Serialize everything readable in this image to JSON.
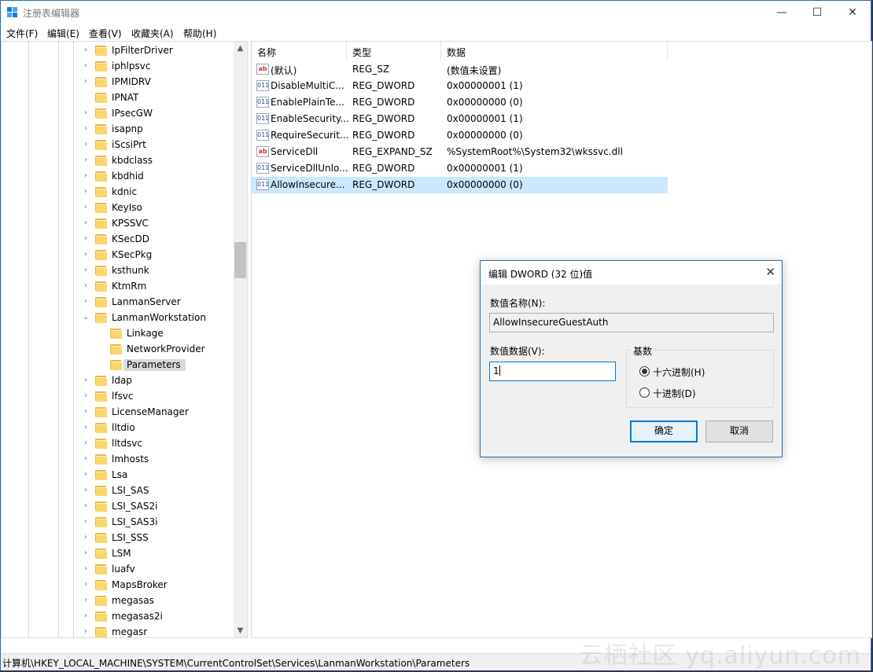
{
  "window": {
    "title": "注册表编辑器",
    "minimize": "—",
    "maximize": "☐",
    "close": "✕"
  },
  "menu": [
    "文件(F)",
    "编辑(E)",
    "查看(V)",
    "收藏夹(A)",
    "帮助(H)"
  ],
  "tree": {
    "items": [
      {
        "label": "IpFilterDriver",
        "depth": 1,
        "expander": "collapsed"
      },
      {
        "label": "iphlpsvc",
        "depth": 1,
        "expander": "collapsed"
      },
      {
        "label": "IPMIDRV",
        "depth": 1,
        "expander": "collapsed"
      },
      {
        "label": "IPNAT",
        "depth": 1,
        "expander": "none"
      },
      {
        "label": "IPsecGW",
        "depth": 1,
        "expander": "collapsed"
      },
      {
        "label": "isapnp",
        "depth": 1,
        "expander": "collapsed"
      },
      {
        "label": "iScsiPrt",
        "depth": 1,
        "expander": "collapsed"
      },
      {
        "label": "kbdclass",
        "depth": 1,
        "expander": "collapsed"
      },
      {
        "label": "kbdhid",
        "depth": 1,
        "expander": "collapsed"
      },
      {
        "label": "kdnic",
        "depth": 1,
        "expander": "collapsed"
      },
      {
        "label": "KeyIso",
        "depth": 1,
        "expander": "collapsed"
      },
      {
        "label": "KPSSVC",
        "depth": 1,
        "expander": "collapsed"
      },
      {
        "label": "KSecDD",
        "depth": 1,
        "expander": "collapsed"
      },
      {
        "label": "KSecPkg",
        "depth": 1,
        "expander": "collapsed"
      },
      {
        "label": "ksthunk",
        "depth": 1,
        "expander": "collapsed"
      },
      {
        "label": "KtmRm",
        "depth": 1,
        "expander": "collapsed"
      },
      {
        "label": "LanmanServer",
        "depth": 1,
        "expander": "collapsed"
      },
      {
        "label": "LanmanWorkstation",
        "depth": 1,
        "expander": "expanded"
      },
      {
        "label": "Linkage",
        "depth": 2,
        "expander": "none"
      },
      {
        "label": "NetworkProvider",
        "depth": 2,
        "expander": "none"
      },
      {
        "label": "Parameters",
        "depth": 2,
        "expander": "none",
        "selected": true
      },
      {
        "label": "ldap",
        "depth": 1,
        "expander": "collapsed"
      },
      {
        "label": "lfsvc",
        "depth": 1,
        "expander": "collapsed"
      },
      {
        "label": "LicenseManager",
        "depth": 1,
        "expander": "collapsed"
      },
      {
        "label": "lltdio",
        "depth": 1,
        "expander": "collapsed"
      },
      {
        "label": "lltdsvc",
        "depth": 1,
        "expander": "collapsed"
      },
      {
        "label": "lmhosts",
        "depth": 1,
        "expander": "collapsed"
      },
      {
        "label": "Lsa",
        "depth": 1,
        "expander": "collapsed"
      },
      {
        "label": "LSI_SAS",
        "depth": 1,
        "expander": "collapsed"
      },
      {
        "label": "LSI_SAS2i",
        "depth": 1,
        "expander": "collapsed"
      },
      {
        "label": "LSI_SAS3i",
        "depth": 1,
        "expander": "collapsed"
      },
      {
        "label": "LSI_SSS",
        "depth": 1,
        "expander": "collapsed"
      },
      {
        "label": "LSM",
        "depth": 1,
        "expander": "collapsed"
      },
      {
        "label": "luafv",
        "depth": 1,
        "expander": "collapsed"
      },
      {
        "label": "MapsBroker",
        "depth": 1,
        "expander": "collapsed"
      },
      {
        "label": "megasas",
        "depth": 1,
        "expander": "collapsed"
      },
      {
        "label": "megasas2i",
        "depth": 1,
        "expander": "collapsed"
      },
      {
        "label": "megasr",
        "depth": 1,
        "expander": "collapsed"
      }
    ]
  },
  "list": {
    "columns": [
      "名称",
      "类型",
      "数据"
    ],
    "rows": [
      {
        "icon": "string-value-icon",
        "name": "(默认)",
        "type": "REG_SZ",
        "data": "(数值未设置)"
      },
      {
        "icon": "binary-value-icon",
        "name": "DisableMultiC...",
        "type": "REG_DWORD",
        "data": "0x00000001 (1)"
      },
      {
        "icon": "binary-value-icon",
        "name": "EnablePlainTe...",
        "type": "REG_DWORD",
        "data": "0x00000000 (0)"
      },
      {
        "icon": "binary-value-icon",
        "name": "EnableSecurity...",
        "type": "REG_DWORD",
        "data": "0x00000001 (1)"
      },
      {
        "icon": "binary-value-icon",
        "name": "RequireSecurit...",
        "type": "REG_DWORD",
        "data": "0x00000000 (0)"
      },
      {
        "icon": "string-value-icon",
        "name": "ServiceDll",
        "type": "REG_EXPAND_SZ",
        "data": "%SystemRoot%\\System32\\wkssvc.dll"
      },
      {
        "icon": "binary-value-icon",
        "name": "ServiceDllUnlo...",
        "type": "REG_DWORD",
        "data": "0x00000001 (1)"
      },
      {
        "icon": "binary-value-icon",
        "name": "AllowInsecure...",
        "type": "REG_DWORD",
        "data": "0x00000000 (0)",
        "selected": true
      }
    ]
  },
  "status": {
    "path": "计算机\\HKEY_LOCAL_MACHINE\\SYSTEM\\CurrentControlSet\\Services\\LanmanWorkstation\\Parameters"
  },
  "watermark": "云栖社区 yq.aliyun.com",
  "dialog": {
    "title": "编辑 DWORD (32 位)值",
    "close": "✕",
    "name_label": "数值名称(N):",
    "name_value": "AllowInsecureGuestAuth",
    "data_label": "数值数据(V):",
    "data_value": "1",
    "base_label": "基数",
    "hex_label": "十六进制(H)",
    "dec_label": "十进制(D)",
    "selected_base": "十六进制(H)",
    "ok_label": "确定",
    "cancel_label": "取消"
  }
}
